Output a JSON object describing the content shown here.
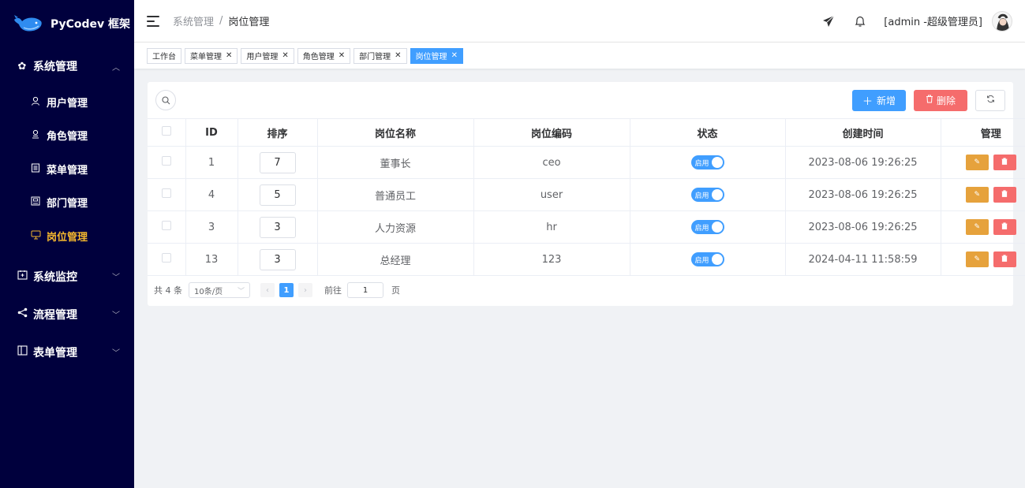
{
  "brand": {
    "name": "PyCodev 框架"
  },
  "sidebar": {
    "groups": [
      {
        "icon": "gear-icon",
        "label": "系统管理",
        "expanded": true,
        "items": [
          {
            "icon": "user-icon",
            "label": "用户管理"
          },
          {
            "icon": "role-icon",
            "label": "角色管理"
          },
          {
            "icon": "menu-icon",
            "label": "菜单管理"
          },
          {
            "icon": "dept-icon",
            "label": "部门管理"
          },
          {
            "icon": "post-icon",
            "label": "岗位管理",
            "active": true
          }
        ]
      },
      {
        "icon": "monitor-icon",
        "label": "系统监控",
        "expanded": false
      },
      {
        "icon": "share-icon",
        "label": "流程管理",
        "expanded": false
      },
      {
        "icon": "form-icon",
        "label": "表单管理",
        "expanded": false
      }
    ]
  },
  "header": {
    "breadcrumb": [
      "系统管理",
      "岗位管理"
    ],
    "user": "[admin -超级管理员]"
  },
  "tags": [
    {
      "label": "工作台",
      "closable": false,
      "active": false
    },
    {
      "label": "菜单管理",
      "closable": true,
      "active": false
    },
    {
      "label": "用户管理",
      "closable": true,
      "active": false
    },
    {
      "label": "角色管理",
      "closable": true,
      "active": false
    },
    {
      "label": "部门管理",
      "closable": true,
      "active": false
    },
    {
      "label": "岗位管理",
      "closable": true,
      "active": true
    }
  ],
  "toolbar": {
    "add_label": "新增",
    "delete_label": "删除"
  },
  "table": {
    "columns": [
      "ID",
      "排序",
      "岗位名称",
      "岗位编码",
      "状态",
      "创建时间",
      "管理"
    ],
    "rows": [
      {
        "id": "1",
        "sort": "7",
        "name": "董事长",
        "code": "ceo",
        "status": "启用",
        "created": "2023-08-06 19:26:25"
      },
      {
        "id": "4",
        "sort": "5",
        "name": "普通员工",
        "code": "user",
        "status": "启用",
        "created": "2023-08-06 19:26:25"
      },
      {
        "id": "3",
        "sort": "3",
        "name": "人力资源",
        "code": "hr",
        "status": "启用",
        "created": "2023-08-06 19:26:25"
      },
      {
        "id": "13",
        "sort": "3",
        "name": "总经理",
        "code": "123",
        "status": "启用",
        "created": "2024-04-11 11:58:59"
      }
    ]
  },
  "pagination": {
    "total_label": "共 4 条",
    "page_size": "10条/页",
    "current_page": "1",
    "goto_label": "前往",
    "goto_value": "1",
    "page_suffix": "页"
  },
  "colors": {
    "sidebar_bg": "#00003d",
    "active_menu": "#f5b82e",
    "primary": "#409eff",
    "danger": "#f56c6c",
    "warning": "#e6a23c"
  }
}
